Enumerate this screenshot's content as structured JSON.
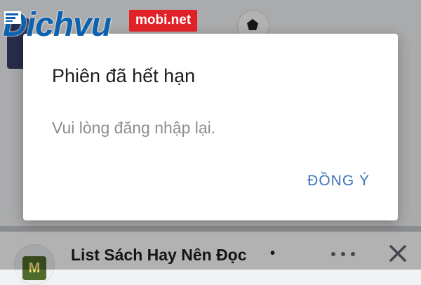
{
  "dialog": {
    "title": "Phiên đã hết hạn",
    "message": "Vui lòng đăng nhập lại.",
    "ok_label": "ĐỒNG Ý"
  },
  "post": {
    "title": "List Sách Hay Nên Đọc",
    "separator": "•",
    "avatar_text": "M",
    "more_icon": "more-horizontal-icon",
    "close_icon": "close-icon"
  },
  "watermark": {
    "brand": "Dichvu",
    "suffix": "mobi.net"
  },
  "colors": {
    "dialog_action": "#3b73b9",
    "watermark_blue": "#0d62ae",
    "watermark_red": "#e02127",
    "overlay": "rgba(0,0,0,0.30)"
  }
}
